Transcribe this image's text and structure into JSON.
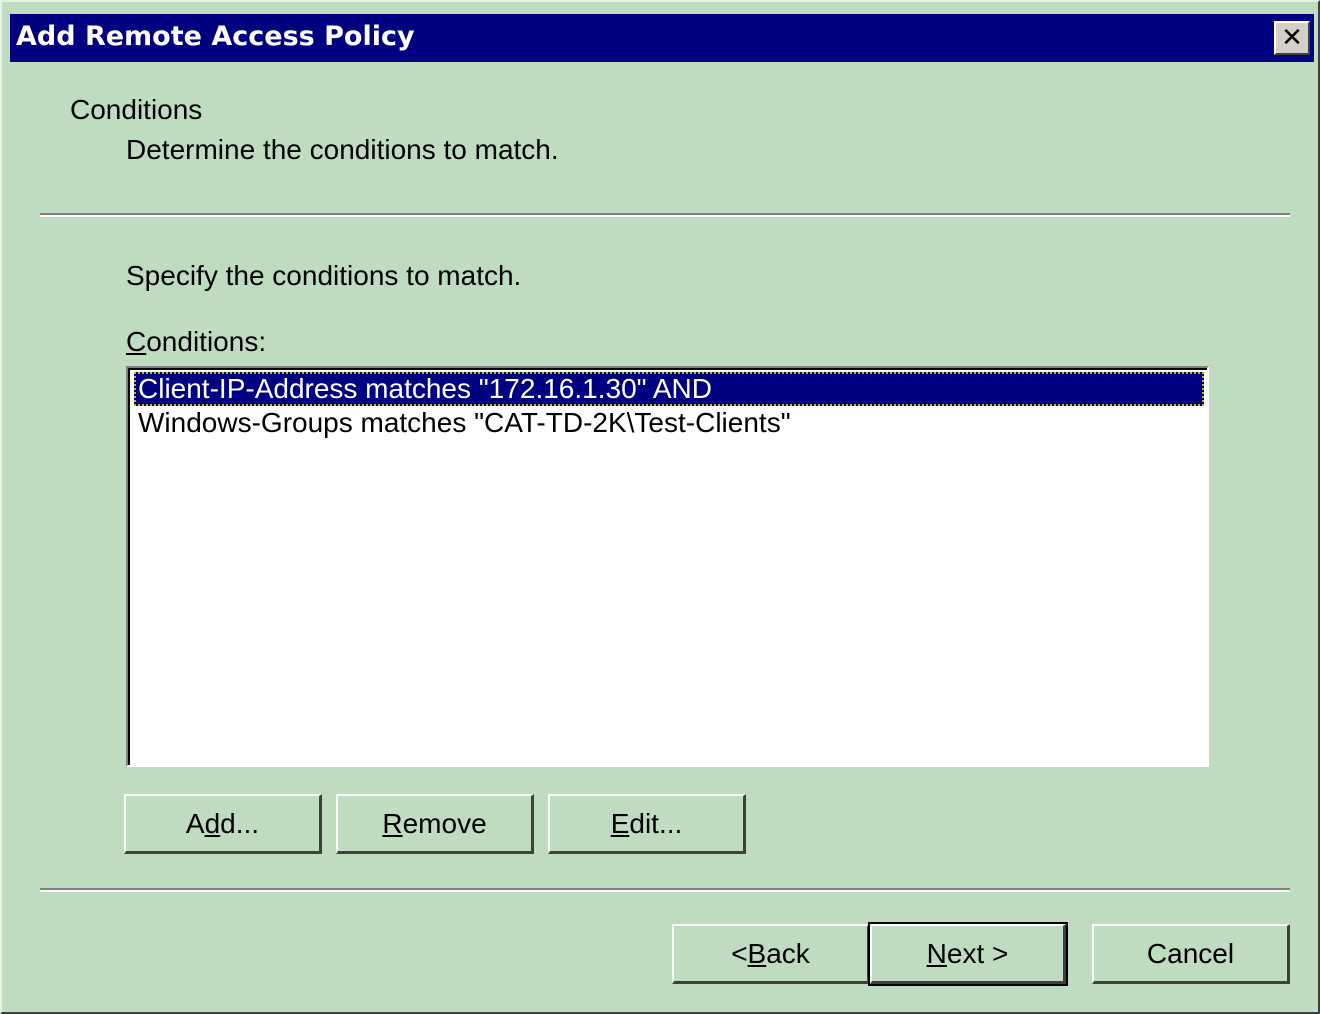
{
  "window": {
    "title": "Add Remote Access Policy",
    "close_glyph": "✕"
  },
  "header": {
    "title": "Conditions",
    "subtitle": "Determine the conditions to match."
  },
  "body": {
    "instruction": "Specify the conditions to match.",
    "list_label_mnemonic": "C",
    "list_label_rest": "onditions:",
    "conditions": [
      "Client-IP-Address matches \"172.16.1.30\"  AND",
      "Windows-Groups matches \"CAT-TD-2K\\Test-Clients\""
    ],
    "selected_index": 0
  },
  "condition_buttons": {
    "add": {
      "pre": "A",
      "mnemonic": "d",
      "post": "d..."
    },
    "remove": {
      "pre": "",
      "mnemonic": "R",
      "post": "emove"
    },
    "edit": {
      "pre": "",
      "mnemonic": "E",
      "post": "dit..."
    }
  },
  "nav_buttons": {
    "back": {
      "pre": "< ",
      "mnemonic": "B",
      "post": "ack"
    },
    "next": {
      "pre": "",
      "mnemonic": "N",
      "post": "ext >"
    },
    "cancel": {
      "label": "Cancel"
    }
  },
  "colors": {
    "dialog_background": "#bfdbc0",
    "titlebar": "#000080",
    "selection": "#000080"
  }
}
